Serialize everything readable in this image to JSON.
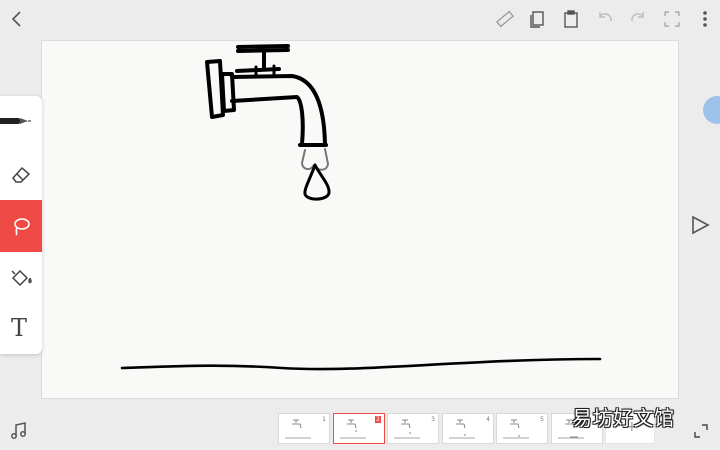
{
  "toolbar": {
    "icons": [
      "back-icon",
      "ruler-icon",
      "copy-frame-icon",
      "paste-frame-icon",
      "undo-icon",
      "redo-icon",
      "fullscreen-icon",
      "more-icon"
    ]
  },
  "tools": {
    "icons": [
      "pen-icon",
      "eraser-icon",
      "lasso-icon",
      "paint-bucket-icon",
      "text-tool-icon"
    ],
    "text_tool_glyph": "T",
    "active": "lasso",
    "active_color": "#ef4a45"
  },
  "frames": {
    "items": [
      {
        "number": "1"
      },
      {
        "number": "2"
      },
      {
        "number": "3"
      },
      {
        "number": "4"
      },
      {
        "number": "5"
      },
      {
        "number": "6"
      }
    ],
    "active_index": 1,
    "add_label": "+"
  },
  "watermark": {
    "text": "易坊好文馆"
  },
  "colors": {
    "background": "#ececec",
    "canvas": "#f9f9f8",
    "accent": "#ef4a45",
    "ink": "#000000"
  }
}
